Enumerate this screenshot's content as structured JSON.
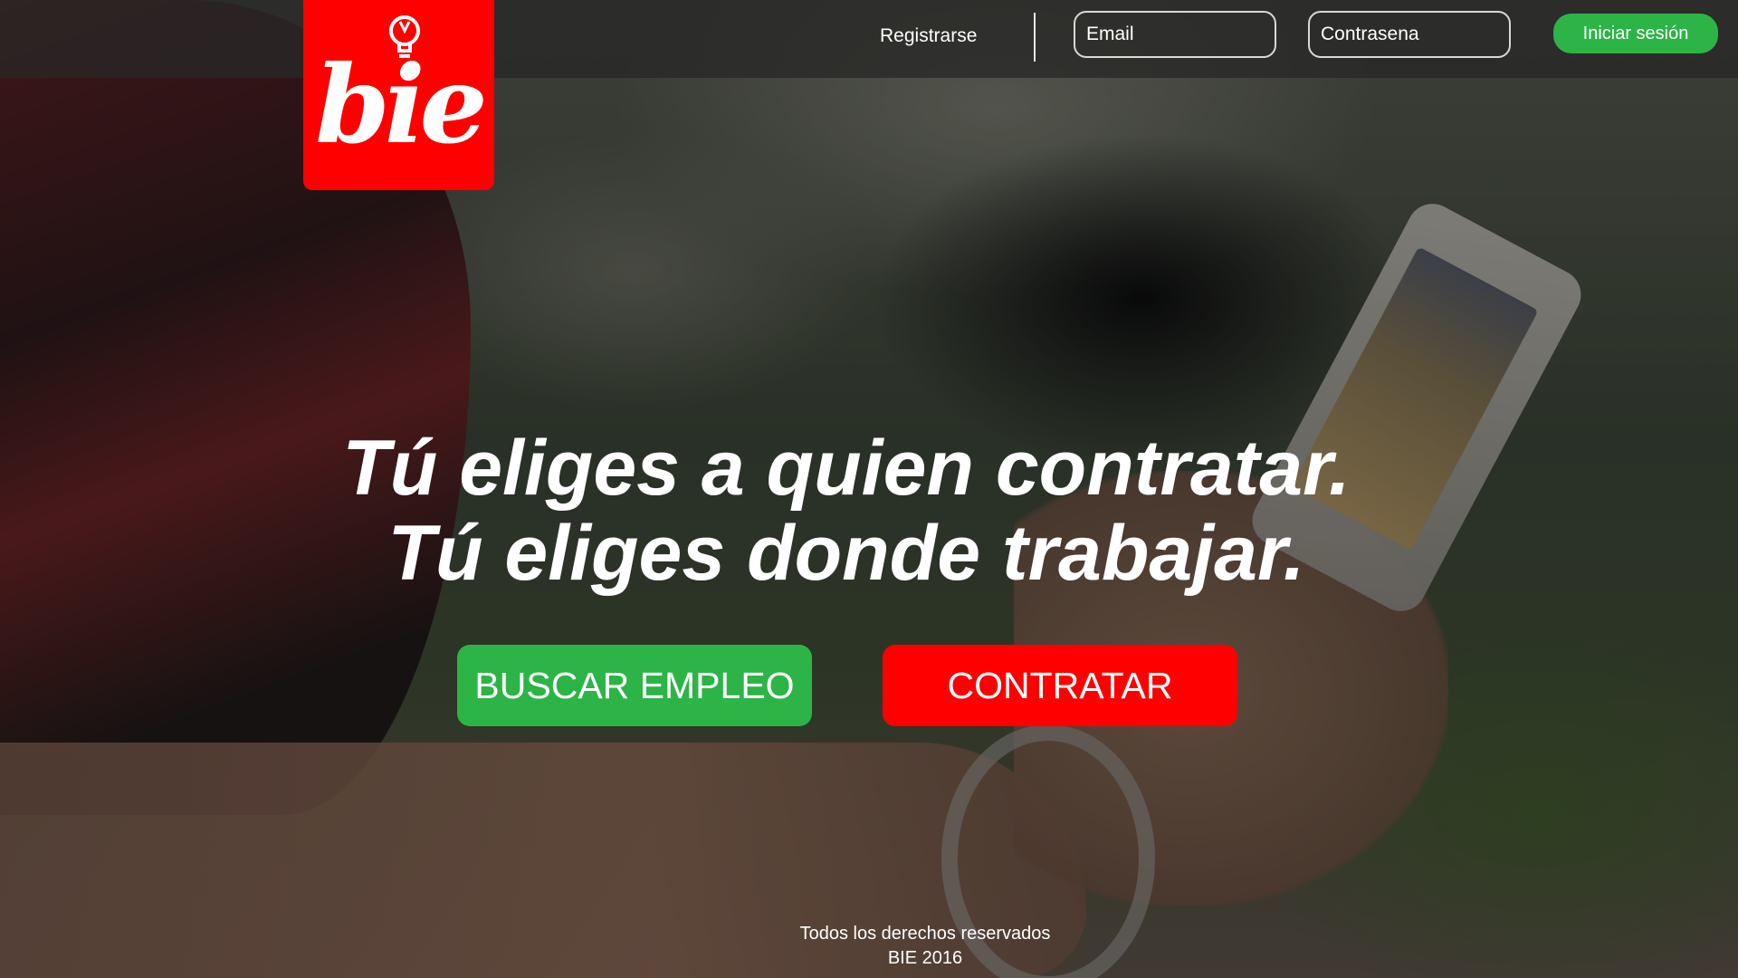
{
  "logo": {
    "text": "bie",
    "icon": "lightbulb-icon"
  },
  "nav": {
    "register_label": "Registrarse",
    "email_placeholder": "Email",
    "password_placeholder": "Contrasena",
    "login_label": "Iniciar sesión"
  },
  "hero": {
    "line1": "Tú eliges a quien contratar.",
    "line2": "Tú eliges donde trabajar.",
    "search_button": "BUSCAR EMPLEO",
    "hire_button": "CONTRATAR"
  },
  "footer": {
    "line1": "Todos los derechos reservados",
    "line2": "BIE 2016"
  },
  "colors": {
    "brand_red": "#ff0000",
    "accent_green": "#2db446"
  }
}
